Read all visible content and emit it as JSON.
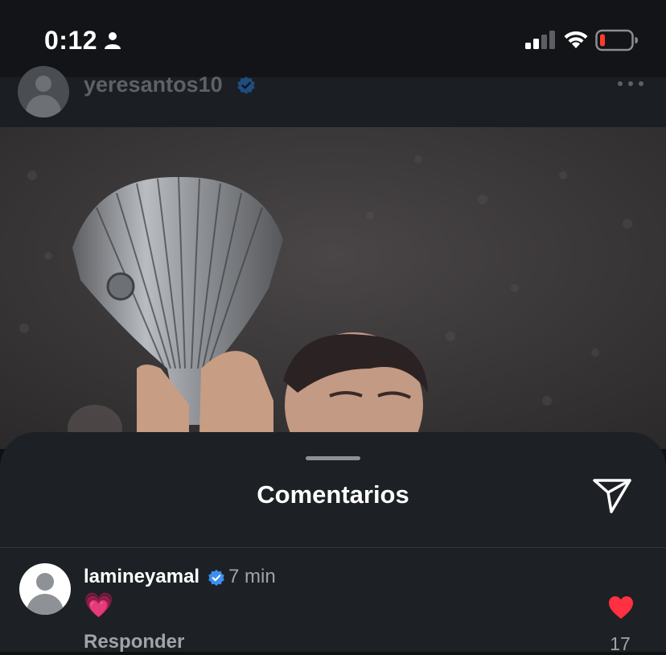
{
  "status_bar": {
    "time": "0:12"
  },
  "post": {
    "username": "yeresantos10"
  },
  "comments_sheet": {
    "title": "Comentarios",
    "comments": [
      {
        "username": "lamineyamal",
        "time": "7 min",
        "text": "💗",
        "reply_label": "Responder",
        "likes": "17"
      }
    ]
  },
  "colors": {
    "accent_verified": "#3b8ff1",
    "like": "#ff3040",
    "battery_low": "#ff3b30"
  },
  "icons": [
    "person-icon",
    "signal-icon",
    "wifi-icon",
    "battery-icon",
    "verified-icon",
    "more-icon",
    "share-icon",
    "heart-icon"
  ]
}
